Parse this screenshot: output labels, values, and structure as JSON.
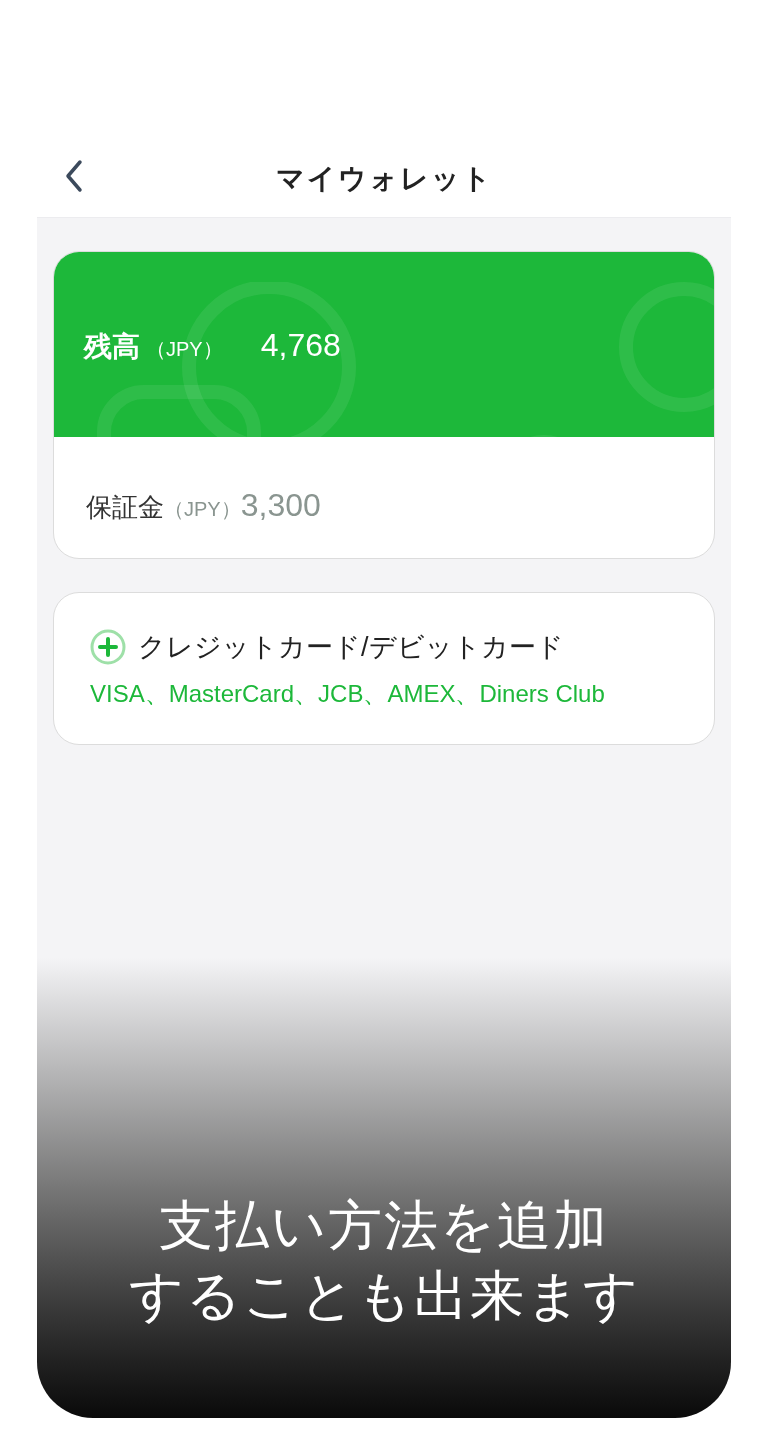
{
  "header": {
    "title": "マイウォレット"
  },
  "balance": {
    "label": "残高",
    "currency": "（JPY）",
    "amount": "4,768"
  },
  "deposit": {
    "label": "保証金",
    "currency": "（JPY）",
    "amount": "3,300"
  },
  "payment_method": {
    "label": "クレジットカード/デビットカード",
    "brands": "VISA、MasterCard、JCB、AMEX、Diners Club"
  },
  "caption": [
    "支払い方法を追加",
    "することも出来ます"
  ]
}
